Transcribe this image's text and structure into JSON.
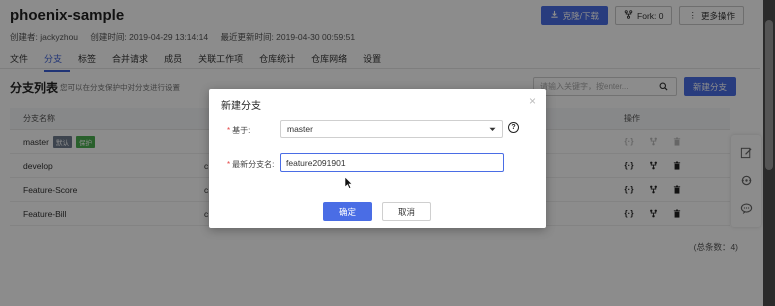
{
  "repo": {
    "title": "phoenix-sample",
    "creator": "创建者: jackyzhou",
    "created": "创建时间: 2019-04-29 13:14:14",
    "updated": "最近更新时间: 2019-04-30 00:59:51"
  },
  "top_buttons": {
    "clone": "克隆/下载",
    "fork": "Fork: 0",
    "more": "更多操作"
  },
  "tabs": [
    "文件",
    "分支",
    "标签",
    "合并请求",
    "成员",
    "关联工作项",
    "仓库统计",
    "仓库网络",
    "设置"
  ],
  "active_tab": "分支",
  "branches": {
    "title": "分支列表",
    "tip": "您可以在分支保护中对分支进行设置",
    "search_placeholder": "请输入关键字，按enter...",
    "new_button": "新建分支",
    "col_name": "分支名称",
    "col_ops": "操作",
    "rows": [
      {
        "name": "master",
        "default": "默认",
        "protect": "保护",
        "mid": ""
      },
      {
        "name": "develop",
        "mid": "c"
      },
      {
        "name": "Feature-Score",
        "mid": "c"
      },
      {
        "name": "Feature-Bill",
        "mid": "c"
      }
    ],
    "total": "(总条数：4)"
  },
  "modal": {
    "title": "新建分支",
    "close": "×",
    "base_label": "基于:",
    "base_value": "master",
    "name_label": "最新分支名:",
    "name_value": "feature2091901",
    "ok": "确定",
    "cancel": "取消",
    "required": "*"
  },
  "colors": {
    "primary": "#4a6de5",
    "tab_active": "#3b5fd8",
    "badge_default": "#6f7d8f",
    "badge_protect": "#4caf50",
    "required": "#e54545"
  }
}
